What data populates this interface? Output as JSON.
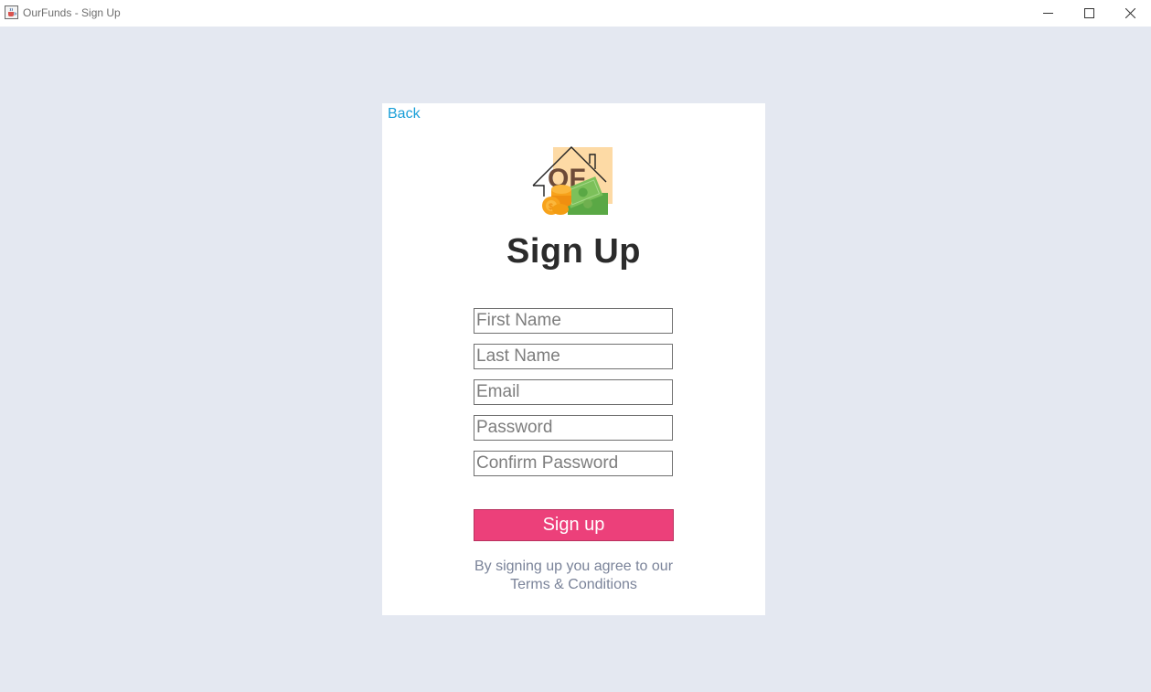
{
  "window": {
    "title": "OurFunds - Sign Up",
    "icon": "java-cup-icon",
    "controls": [
      "minimize-icon",
      "maximize-icon",
      "close-icon"
    ]
  },
  "card": {
    "back_label": "Back",
    "logo": {
      "text": "OF",
      "icon": "house-money-logo",
      "colors": {
        "house_bg": "#fddaa5",
        "text": "#6d4b38",
        "money": "#7cc05a",
        "coins": "#f7a21b"
      }
    },
    "heading": "Sign Up",
    "fields": {
      "first_name": {
        "placeholder": "First Name",
        "value": ""
      },
      "last_name": {
        "placeholder": "Last Name",
        "value": ""
      },
      "email": {
        "placeholder": "Email",
        "value": ""
      },
      "password": {
        "placeholder": "Password",
        "value": ""
      },
      "confirm_password": {
        "placeholder": "Confirm Password",
        "value": ""
      }
    },
    "signup_button": "Sign up",
    "terms_line1": "By signing up you agree to our",
    "terms_link": "Terms & Conditions"
  },
  "colors": {
    "background": "#e4e8f1",
    "accent": "#ec407a",
    "link": "#1a9fd8",
    "muted_text": "#7a8399"
  }
}
